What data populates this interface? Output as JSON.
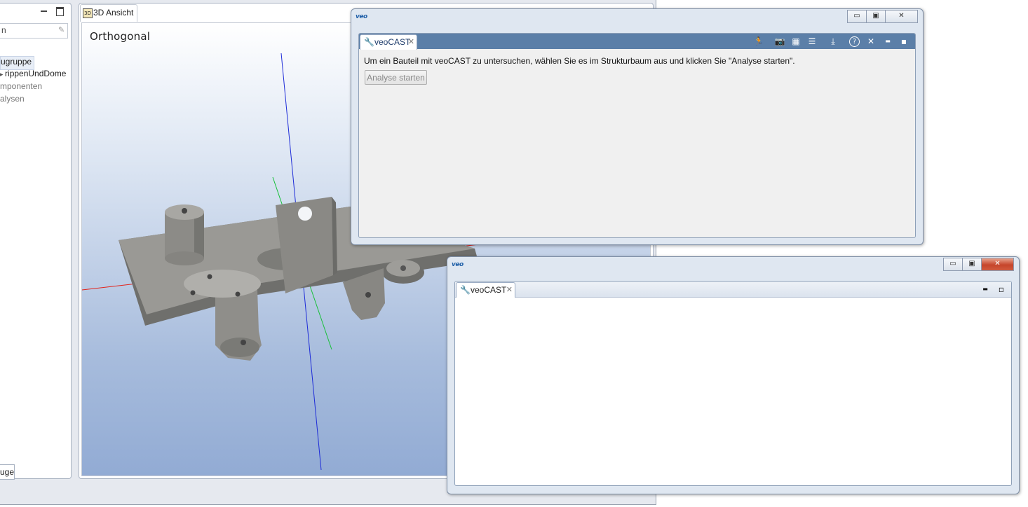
{
  "main": {
    "tree": {
      "search_value": "n",
      "items": [
        "ugruppe",
        "rippenUndDome",
        "mponenten",
        "alysen"
      ]
    },
    "left_bottom_tab": "uge",
    "view_tab_icon": "3D",
    "view_tab_label": "3D Ansicht",
    "view_label": "Orthogonal"
  },
  "window1": {
    "logo": "veo",
    "buttons": {
      "minimize": "▭",
      "maximize": "▣",
      "close": "✕"
    },
    "tab_label": "veoCAST",
    "tab_close": "✕",
    "toolbar_icons": [
      "run-icon",
      "camera-icon",
      "report-icon",
      "document-icon",
      "export-icon",
      "help-icon",
      "close-icon",
      "minimize-icon",
      "maximize-icon"
    ],
    "toolbar_glyphs": {
      "run": "🏃",
      "camera": "📷",
      "report": "▦",
      "doc": "☰",
      "export": "⤓",
      "help": "?",
      "close": "✕",
      "min": "▬",
      "max": "▪"
    },
    "hint": "Um ein Bauteil mit veoCAST zu untersuchen, wählen Sie es im Strukturbaum aus und klicken Sie \"Analyse starten\".",
    "analyse_button": "Analyse starten"
  },
  "window2": {
    "logo": "veo",
    "buttons": {
      "minimize": "▭",
      "maximize": "▣",
      "close": "✕"
    },
    "tab_label": "veoCAST",
    "tab_close": "✕",
    "panel_buttons": {
      "minimize": "▬",
      "maximize": "▫"
    }
  },
  "colors": {
    "header_blue": "#5b7fa8",
    "axis_red": "#e2231a",
    "axis_green": "#18c03a",
    "axis_blue": "#1d2bd8",
    "part_gray": "#8b8b87"
  }
}
